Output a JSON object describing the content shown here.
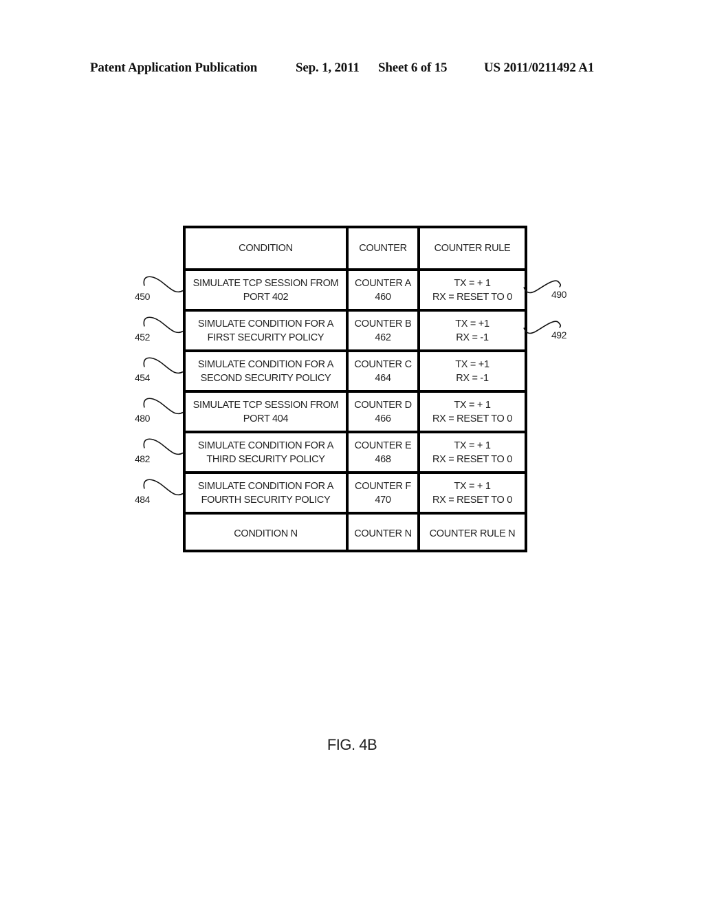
{
  "header": {
    "publication": "Patent Application Publication",
    "date": "Sep. 1, 2011",
    "sheet": "Sheet 6 of 15",
    "patent_number": "US 2011/0211492 A1"
  },
  "table": {
    "columns": [
      "CONDITION",
      "COUNTER",
      "COUNTER RULE"
    ],
    "rows": [
      {
        "condition": "SIMULATE TCP SESSION FROM\nPORT 402",
        "counter": "COUNTER  A\n460",
        "rule": "TX = + 1\nRX = RESET TO 0",
        "left_ref": "450",
        "right_ref": "490"
      },
      {
        "condition": "SIMULATE CONDITION FOR A\nFIRST SECURITY POLICY",
        "counter": "COUNTER B\n462",
        "rule": "TX = +1\nRX = -1",
        "left_ref": "452",
        "right_ref": "492"
      },
      {
        "condition": "SIMULATE CONDITION FOR A\nSECOND SECURITY POLICY",
        "counter": "COUNTER C\n464",
        "rule": "TX = +1\nRX = -1",
        "left_ref": "454"
      },
      {
        "condition": "SIMULATE TCP SESSION FROM\nPORT 404",
        "counter": "COUNTER D\n466",
        "rule": "TX = + 1\nRX = RESET TO 0",
        "left_ref": "480"
      },
      {
        "condition": "SIMULATE CONDITION FOR A\nTHIRD SECURITY POLICY",
        "counter": "COUNTER E\n468",
        "rule": "TX = + 1\nRX = RESET TO 0",
        "left_ref": "482"
      },
      {
        "condition": "SIMULATE CONDITION FOR A\nFOURTH SECURITY POLICY",
        "counter": "COUNTER F\n470",
        "rule": "TX = + 1\nRX = RESET TO 0",
        "left_ref": "484"
      },
      {
        "condition": "CONDITION N",
        "counter": "COUNTER N",
        "rule": "COUNTER RULE N"
      }
    ]
  },
  "figure_label": "FIG. 4B"
}
